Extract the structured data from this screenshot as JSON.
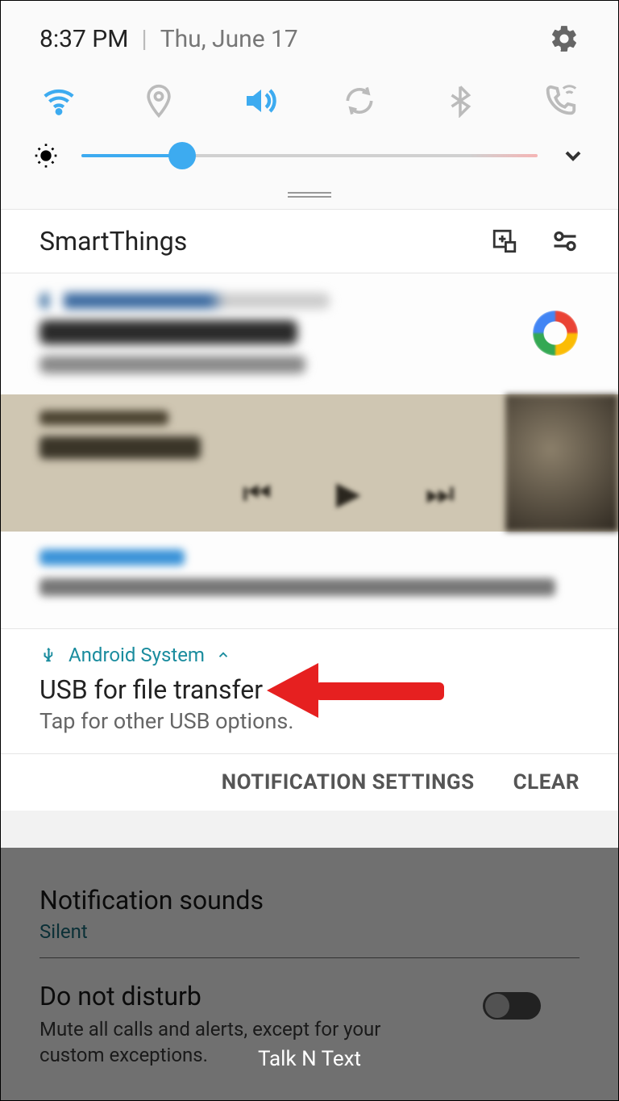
{
  "status": {
    "time": "8:37 PM",
    "date": "Thu, June 17"
  },
  "qs": {
    "wifi": "wifi-icon",
    "location": "location-icon",
    "sound": "sound-icon",
    "rotate": "rotate-icon",
    "bluetooth": "bluetooth-icon",
    "wificall": "wifi-calling-icon"
  },
  "brightness": {
    "percent": 22
  },
  "smartthings": {
    "title": "SmartThings"
  },
  "usb": {
    "app": "Android System",
    "title": "USB for file transfer",
    "sub": "Tap for other USB options."
  },
  "actions": {
    "settings": "NOTIFICATION SETTINGS",
    "clear": "CLEAR"
  },
  "bg": {
    "notif_sounds": {
      "title": "Notification sounds",
      "value": "Silent"
    },
    "dnd": {
      "title": "Do not disturb",
      "sub": "Mute all calls and alerts, except for your custom exceptions."
    }
  },
  "carrier": "Talk N Text"
}
